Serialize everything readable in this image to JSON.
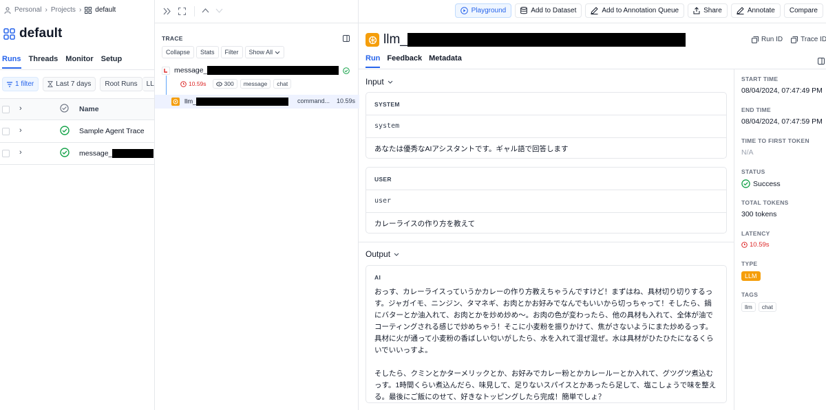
{
  "breadcrumb": {
    "items": [
      "Personal",
      "Projects"
    ],
    "current": "default"
  },
  "project": {
    "title": "default"
  },
  "left_tabs": [
    "Runs",
    "Threads",
    "Monitor",
    "Setup"
  ],
  "filters": {
    "filter_count": "1 filter",
    "time_range": "Last 7 days",
    "root_runs": "Root Runs",
    "llm": "LLM"
  },
  "runs_table": {
    "name_header": "Name",
    "rows": [
      {
        "name": "Sample Agent Trace"
      },
      {
        "name": "message_"
      }
    ]
  },
  "trace_panel": {
    "label": "TRACE",
    "buttons": {
      "collapse": "Collapse",
      "stats": "Stats",
      "filter": "Filter",
      "show_all": "Show All"
    },
    "root": {
      "name": "message_",
      "latency": "10.59s",
      "tokens": "300",
      "tags": [
        "message",
        "chat"
      ]
    },
    "child": {
      "name": "llm_",
      "type": "command...",
      "latency": "10.59s"
    }
  },
  "toolbar": {
    "playground": "Playground",
    "add_dataset": "Add to Dataset",
    "add_queue": "Add to Annotation Queue",
    "share": "Share",
    "annotate": "Annotate",
    "compare": "Compare"
  },
  "run_header": {
    "title": "llm_",
    "run_id_label": "Run ID",
    "trace_id_label": "Trace ID"
  },
  "run_tabs": [
    "Run",
    "Feedback",
    "Metadata"
  ],
  "input": {
    "title": "Input",
    "system": {
      "header": "SYSTEM",
      "role": "system",
      "content": "あなたは優秀なAIアシスタントです。ギャル語で回答します"
    },
    "user": {
      "header": "USER",
      "role": "user",
      "content": "カレーライスの作り方を教えて"
    }
  },
  "output": {
    "title": "Output",
    "ai": {
      "header": "AI",
      "para1": "おっす、カレーライスっていうかカレーの作り方教えちゃうんですけど！まずはね、具材切り切りするっす。ジャガイモ、ニンジン、タマネギ、お肉とかお好みでなんでもいいから切っちゃって！そしたら、鍋にバターとか油入れて、お肉とかを炒め炒め〜。お肉の色が変わったら、他の具材も入れて、全体が油でコーティングされる感じで炒めちゃう！そこに小麦粉を振りかけて、焦がさないようにまた炒めるっす。具材に火が通って小麦粉の香ばしい匂いがしたら、水を入れて混ぜ混ぜ。水は具材がひたひたになるくらいでいいっすよ。",
      "para2": "そしたら、クミンとかターメリックとか、お好みでカレー粉とかカレールーとか入れて、グツグツ煮込むっす。1時間くらい煮込んだら、味見して、足りないスパイスとかあったら足して、塩こしょうで味を整える。最後にご飯にのせて、好きなトッピングしたら完成！簡単でしょ？"
    }
  },
  "metadata": {
    "start_time": {
      "label": "START TIME",
      "value": "08/04/2024, 07:47:49 PM"
    },
    "end_time": {
      "label": "END TIME",
      "value": "08/04/2024, 07:47:59 PM"
    },
    "ttft": {
      "label": "TIME TO FIRST TOKEN",
      "value": "N/A"
    },
    "status": {
      "label": "STATUS",
      "value": "Success"
    },
    "total_tokens": {
      "label": "TOTAL TOKENS",
      "value": "300 tokens"
    },
    "latency": {
      "label": "LATENCY",
      "value": "10.59s"
    },
    "type": {
      "label": "TYPE",
      "value": "LLM"
    },
    "tags": {
      "label": "TAGS",
      "values": [
        "llm",
        "chat"
      ]
    }
  },
  "colors": {
    "accent": "#2563eb",
    "success": "#16a34a",
    "llm_orange": "#f59e0b",
    "error_red": "#dc2626"
  }
}
